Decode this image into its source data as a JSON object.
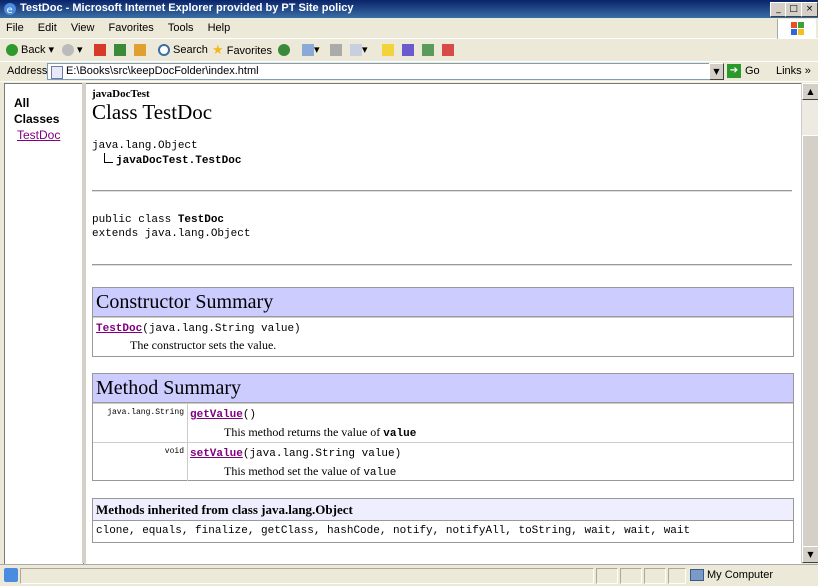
{
  "window": {
    "title": "TestDoc - Microsoft Internet Explorer provided by PT Site policy",
    "controls": [
      "_",
      "□",
      "×"
    ]
  },
  "menu": [
    "File",
    "Edit",
    "View",
    "Favorites",
    "Tools",
    "Help"
  ],
  "toolbar": {
    "back": "Back",
    "search": "Search",
    "favorites": "Favorites"
  },
  "address": {
    "label": "Address",
    "url": "E:\\Books\\src\\keepDocFolder\\index.html",
    "go": "Go",
    "links": "Links"
  },
  "left_frame": {
    "heading_line1": "All",
    "heading_line2": "Classes",
    "class_link": "TestDoc"
  },
  "doc": {
    "package": "javaDocTest",
    "class_title": "Class TestDoc",
    "hierarchy_root": "java.lang.Object",
    "hierarchy_child": "javaDocTest.TestDoc",
    "decl_prefix": "public class ",
    "decl_name": "TestDoc",
    "decl_extends": "extends java.lang.Object",
    "constructor_summary": {
      "heading": "Constructor Summary",
      "name": "TestDoc",
      "signature": "(java.lang.String value)",
      "description": "The constructor sets the value."
    },
    "method_summary": {
      "heading": "Method Summary",
      "methods": [
        {
          "type": "java.lang.String",
          "name": "getValue",
          "signature": "()",
          "description": "This method returns the value of ",
          "description_code": "value"
        },
        {
          "type": "void",
          "name": "setValue",
          "signature": "(java.lang.String value)",
          "description": "This method set the value of ",
          "description_code": "value"
        }
      ]
    },
    "inherited": {
      "heading": "Methods inherited from class java.lang.Object",
      "list": "clone, equals, finalize, getClass, hashCode, notify, notifyAll, toString, wait, wait, wait"
    }
  },
  "status": {
    "zone": "My Computer"
  },
  "colors": {
    "title_bar": "#0A246A",
    "table_header": "#CCCCFF",
    "inherited_header": "#EEEEFF",
    "visited_link": "#800080"
  }
}
